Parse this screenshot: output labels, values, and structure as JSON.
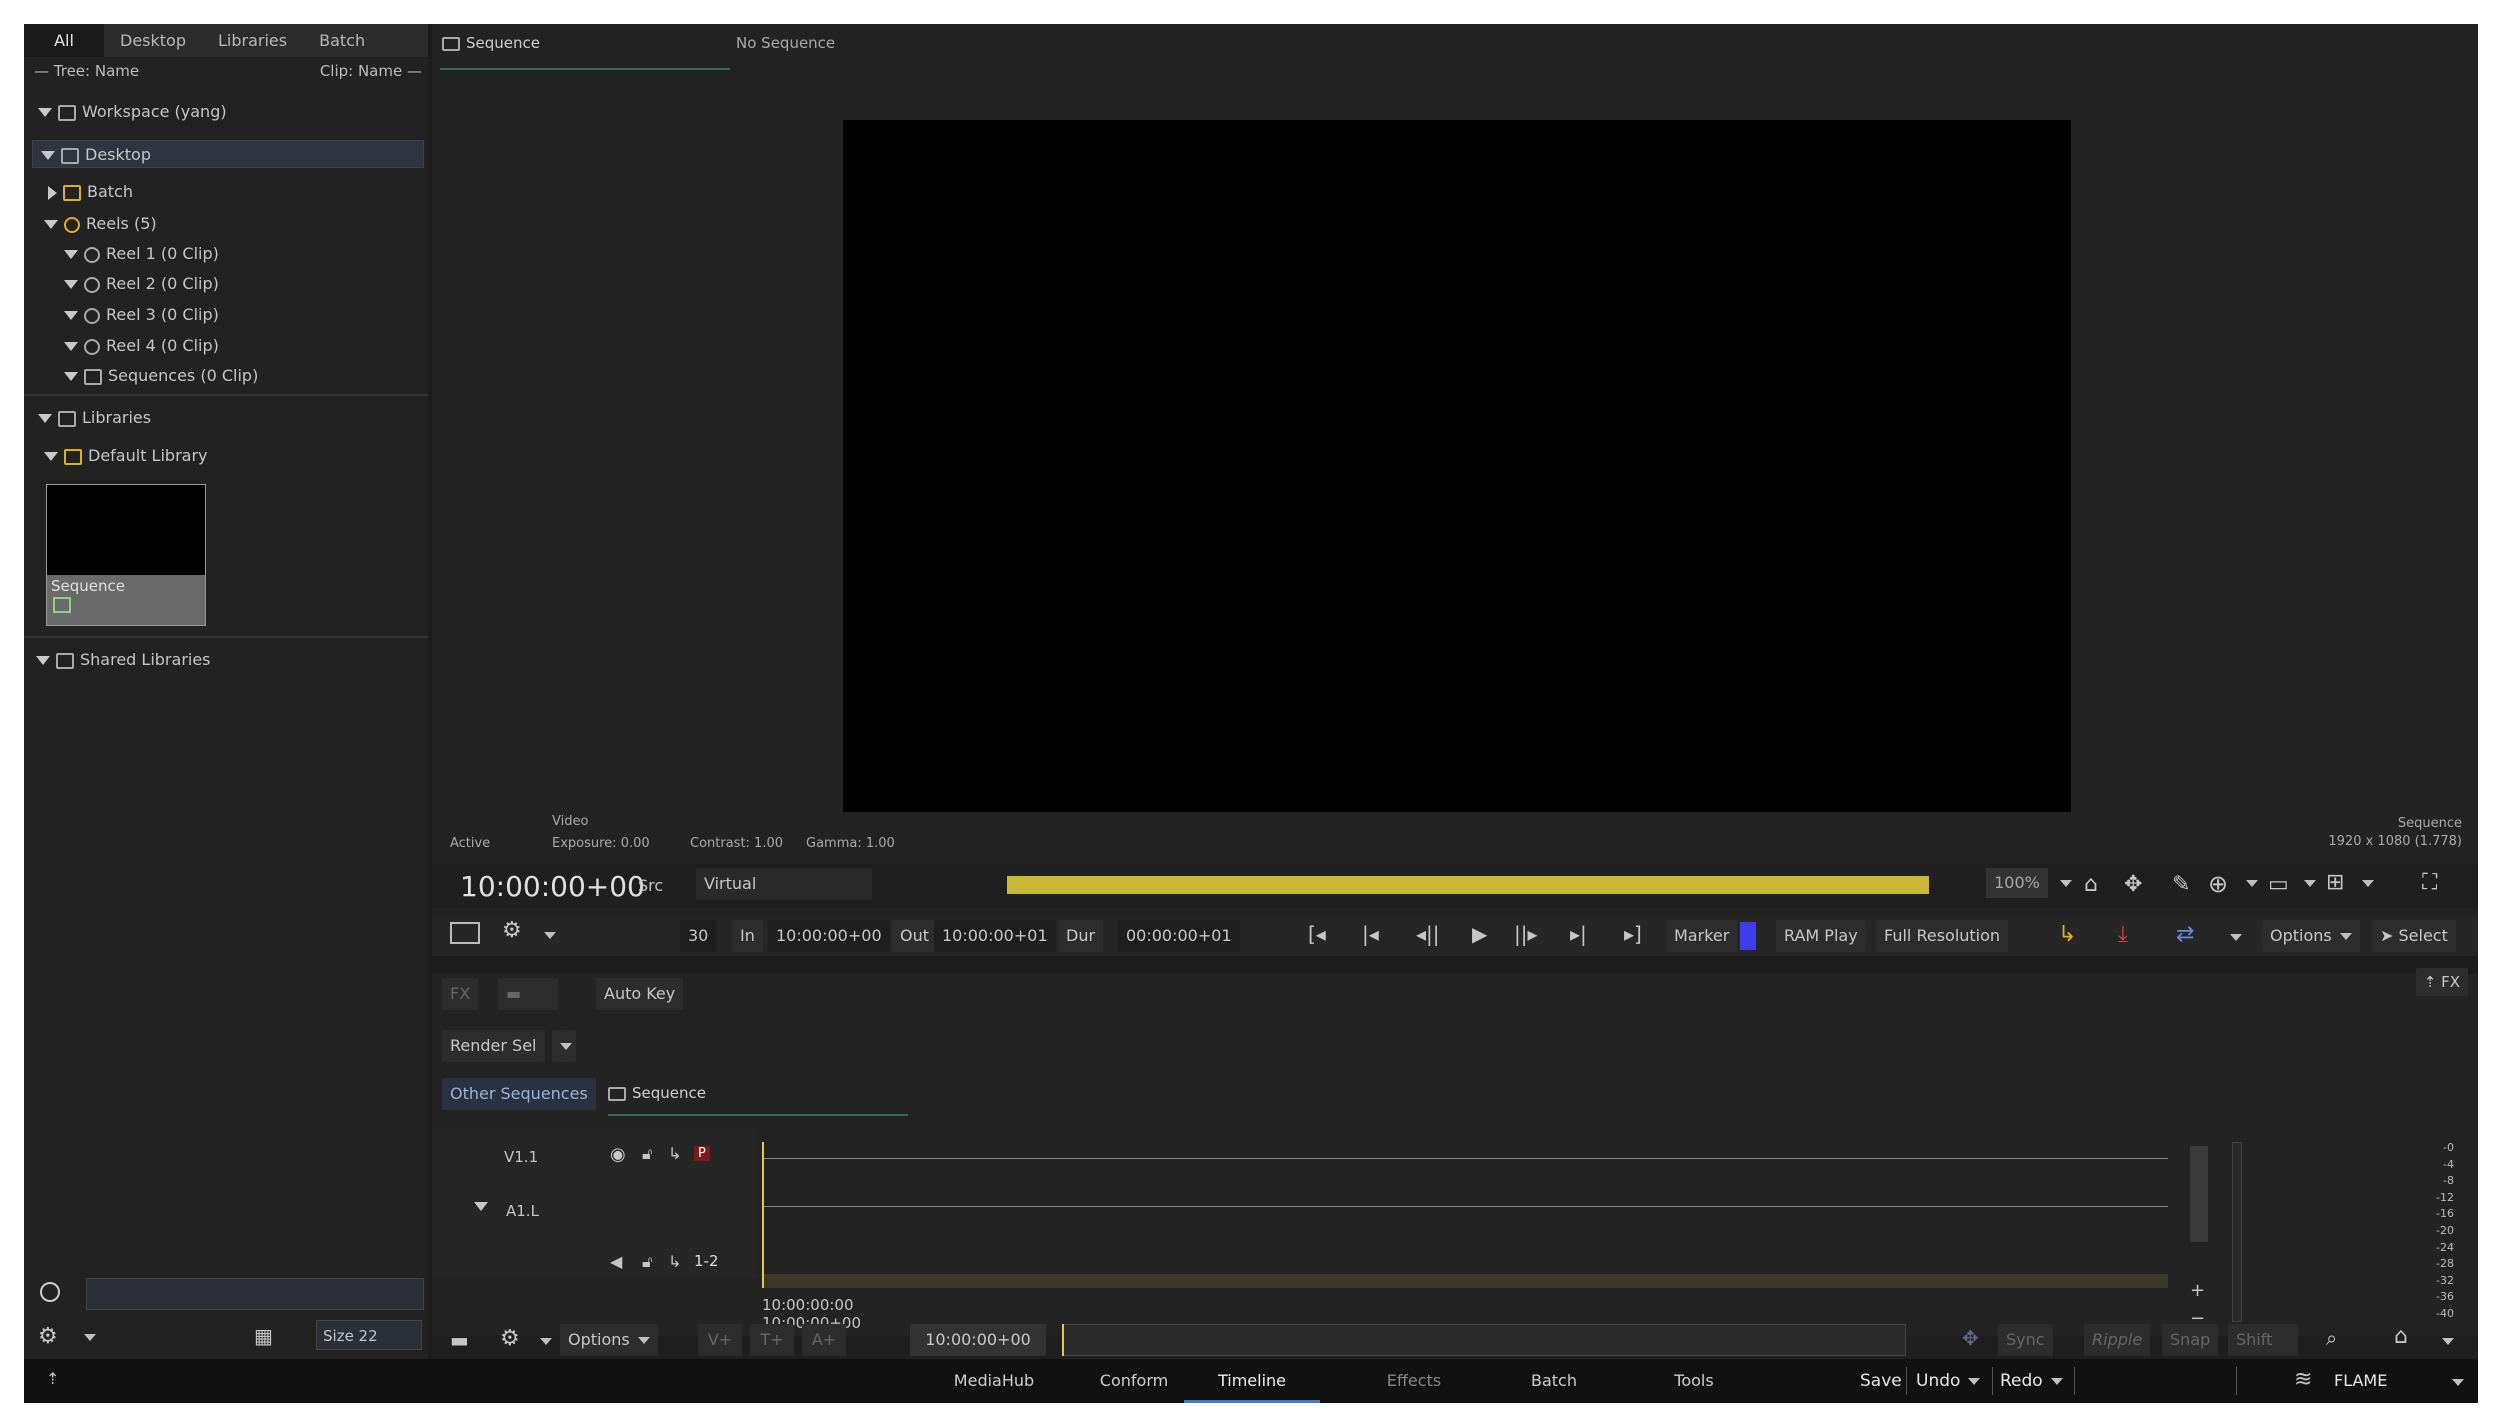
{
  "left_panel": {
    "tabs": [
      "All",
      "Desktop",
      "Libraries",
      "Batch"
    ],
    "tree_header_left": "— Tree: Name",
    "tree_header_right": "Clip: Name —",
    "workspace": "Workspace (yang)",
    "desktop": "Desktop",
    "batch": "Batch",
    "reels": "Reels (5)",
    "reel_items": [
      "Reel 1 (0 Clip)",
      "Reel 2 (0 Clip)",
      "Reel 3 (0 Clip)",
      "Reel 4 (0 Clip)",
      "Sequences (0 Clip)"
    ],
    "libraries": "Libraries",
    "default_library": "Default Library",
    "thumb_label": "Sequence",
    "shared_libraries": "Shared Libraries",
    "search_value": "",
    "size_label": "Size 22"
  },
  "viewer": {
    "tab_name": "Sequence",
    "tab_right": "No Sequence",
    "info_video": "Video",
    "info_active": "Active",
    "info_exposure": "Exposure: 0.00",
    "info_contrast": "Contrast: 1.00",
    "info_gamma": "Gamma: 1.00",
    "info_seq_name": "Sequence",
    "info_seq_res": "1920 x 1080 (1.778)",
    "timecode": "10:00:00+00",
    "src": "Src",
    "virtual": "Virtual",
    "zoom": "100%",
    "fps": "30",
    "in_label": "In",
    "in_value": "10:00:00+00",
    "out_label": "Out",
    "out_value": "10:00:00+01",
    "dur_label": "Dur",
    "dur_value": "00:00:00+01",
    "marker": "Marker",
    "marker_color": "#3d3df0",
    "ram_play": "RAM Play",
    "full_res": "Full Resolution",
    "options": "Options",
    "select": "Select",
    "playback_bar_color": "#c9b735"
  },
  "timeline": {
    "fx_btn": "FX",
    "auto_key": "Auto Key",
    "render_sel": "Render Sel",
    "fx_right": "FX",
    "other_sequences": "Other Sequences",
    "seq_tab": "Sequence",
    "track_v": "V1.1",
    "track_a": "A1.L",
    "p_label": "P",
    "ch_label": "1-2",
    "tc_top": "10:00:00:00",
    "tc_bottom": "10:00:00+00",
    "meter_ticks": [
      "-0",
      "-4",
      "-8",
      "-12",
      "-16",
      "-20",
      "-24",
      "-28",
      "-32",
      "-36",
      "-40"
    ],
    "options": "Options",
    "vplus": "V+",
    "tplus": "T+",
    "aplus": "A+",
    "tc_field": "10:00:00+00",
    "sync": "Sync",
    "ripple": "Ripple",
    "snap": "Snap",
    "shift": "Shift"
  },
  "bottom": {
    "tabs": [
      "MediaHub",
      "Conform",
      "Timeline",
      "Effects",
      "Batch",
      "Tools"
    ],
    "active_tab": "Timeline",
    "save": "Save",
    "undo": "Undo",
    "redo": "Redo",
    "brand": "FLAME"
  }
}
